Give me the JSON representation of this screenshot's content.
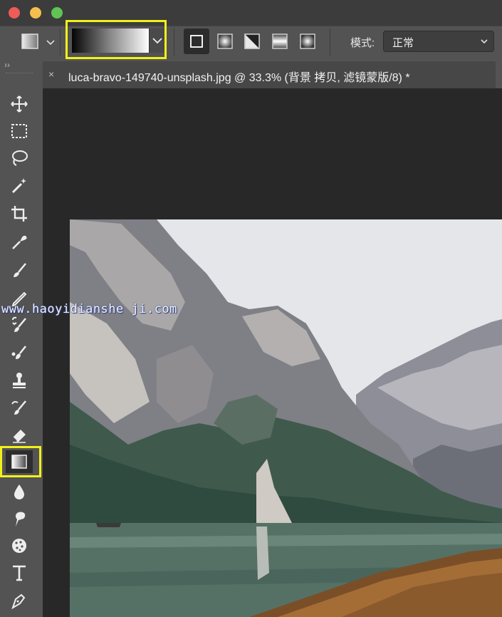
{
  "window": {
    "traffic_lights": [
      "close",
      "minimize",
      "zoom"
    ],
    "colors": {
      "close": "#ee5c57",
      "minimize": "#f4bf4f",
      "zoom": "#5fc454"
    }
  },
  "options_bar": {
    "tool_preset_icon": "gradient-tool-preset-icon",
    "gradient_preview_icon": "gradient-picker-icon",
    "gradient_types": [
      "linear",
      "radial",
      "angle",
      "reflected",
      "diamond"
    ],
    "mode_label": "模式:",
    "mode_value": "正常",
    "highlight_color": "#f1f11a"
  },
  "document_tab": {
    "title": "luca-bravo-149740-unsplash.jpg @ 33.3% (背景 拷贝, 滤镜蒙版/8) *",
    "close": "×"
  },
  "toolbox": {
    "collapse": "››",
    "tools": [
      "move",
      "rect-marquee",
      "lasso",
      "magic-wand",
      "crop",
      "eyedropper",
      "brush",
      "pencil",
      "healing-brush",
      "mixer-brush",
      "stamp",
      "history-brush",
      "eraser",
      "gradient",
      "blur",
      "smudge",
      "sponge",
      "type",
      "pen"
    ],
    "active_tool": "gradient"
  },
  "watermark": "www.haoyidianshe ji.com"
}
